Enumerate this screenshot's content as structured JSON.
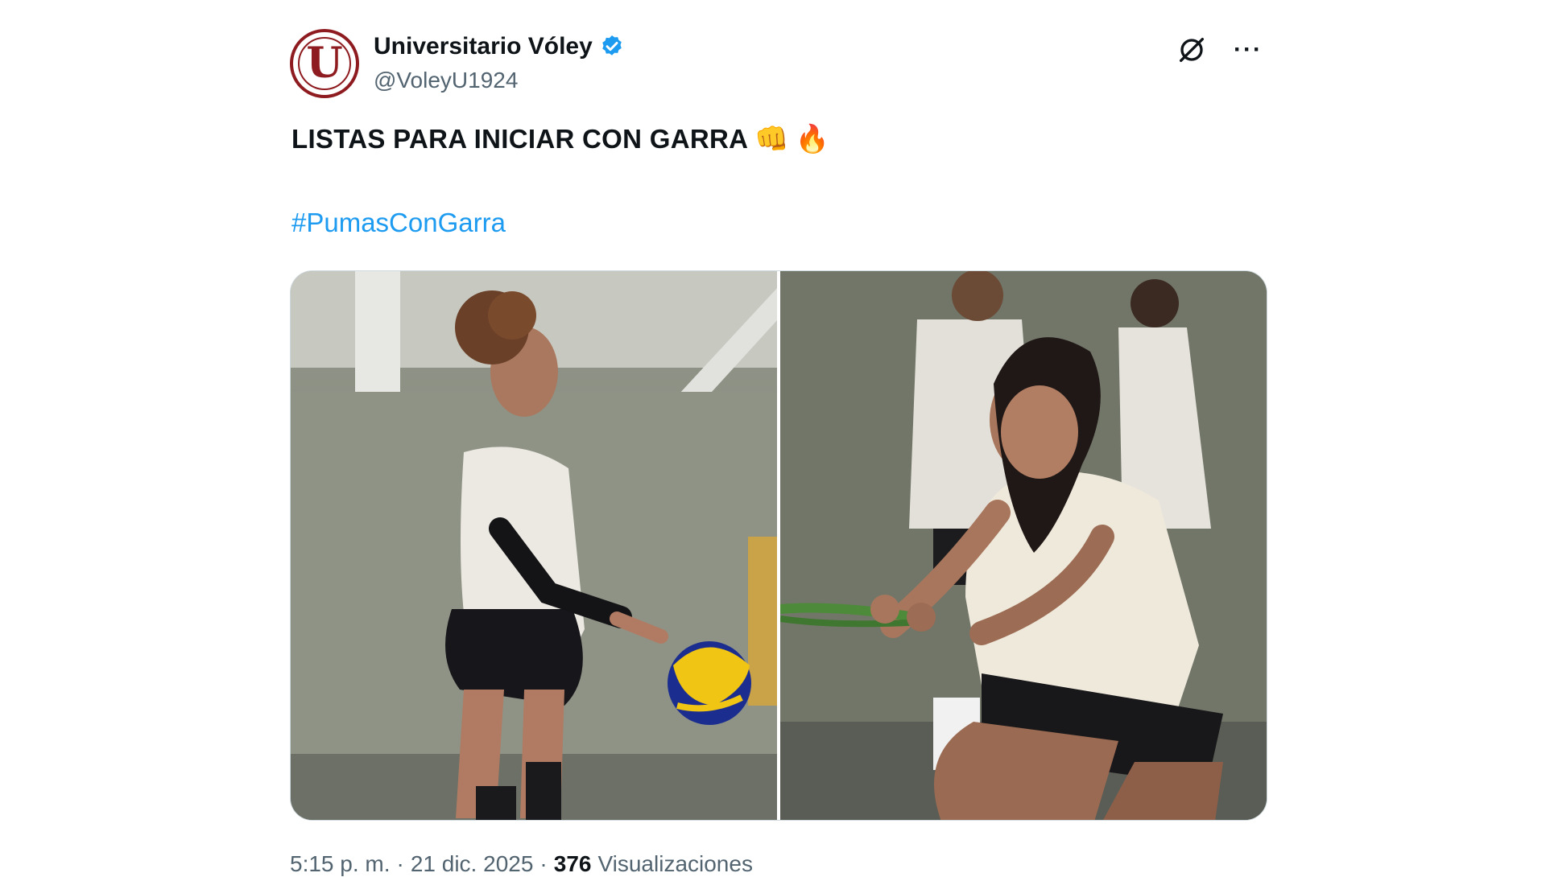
{
  "account": {
    "display_name": "Universitario Vóley",
    "handle": "@VoleyU1924",
    "avatar_letter": "U",
    "brand_color": "#8e1b1f",
    "verified_color": "#1d9bf0"
  },
  "actions": {
    "grok_icon": "grok-icon",
    "more_label": "···"
  },
  "post": {
    "text": "LISTAS PARA INICIAR CON GARRA",
    "emojis": [
      "👊",
      "🔥"
    ],
    "hashtag": "#PumasConGarra"
  },
  "media": {
    "photos": [
      {
        "name": "volleyball-player-serving-photo"
      },
      {
        "name": "volleyball-player-resistance-band-photo"
      }
    ]
  },
  "meta": {
    "time": "5:15 p. m.",
    "separator": "·",
    "date": "21 dic. 2025",
    "views_count": "376",
    "views_label": "Visualizaciones"
  }
}
